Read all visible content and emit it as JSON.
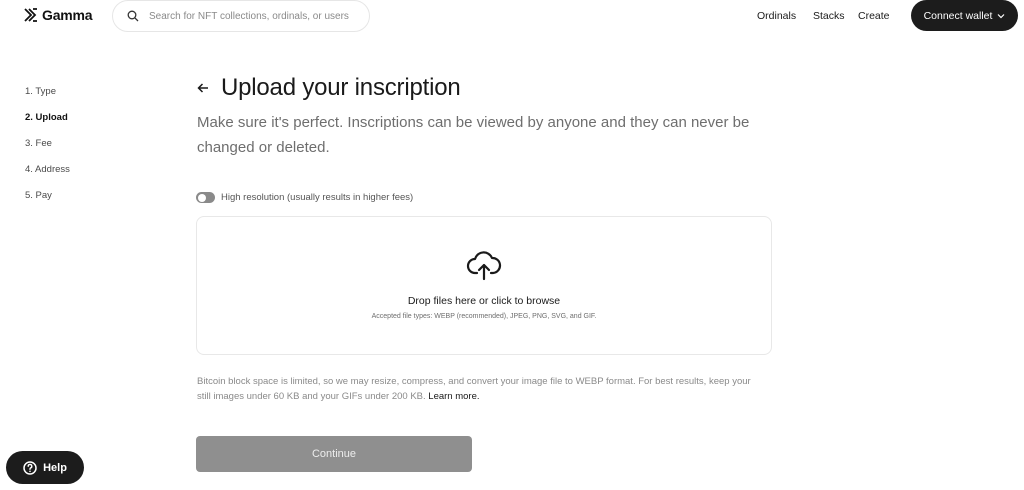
{
  "header": {
    "brand": "Gamma",
    "search_placeholder": "Search for NFT collections, ordinals, or users",
    "nav": [
      "Ordinals",
      "Stacks",
      "Create"
    ],
    "connect_label": "Connect wallet"
  },
  "steps": [
    "1. Type",
    "2. Upload",
    "3. Fee",
    "4. Address",
    "5. Pay"
  ],
  "active_step": "2. Upload",
  "main": {
    "title": "Upload your inscription",
    "subtitle": "Make sure it's perfect. Inscriptions can be viewed by anyone and they can never be changed or deleted.",
    "toggle_label": "High resolution (usually results in higher fees)",
    "toggle_on": false,
    "drop_main": "Drop files here or click to browse",
    "drop_sub": "Accepted file types: WEBP (recommended), JPEG, PNG, SVG, and GIF.",
    "note": "Bitcoin block space is limited, so we may resize, compress, and convert your image file to WEBP format. For best results, keep your still images under 60 KB and your GIFs under 200 KB.",
    "learn_more": "Learn more.",
    "continue_label": "Continue"
  },
  "help_label": "Help",
  "colors": {
    "primary_dark": "#1c1c1c",
    "disabled_button": "#8f8f8f",
    "muted_text": "#6e6e6e",
    "border": "#e8e8e8"
  },
  "icons": [
    "gamma-logo-icon",
    "search-icon",
    "chevron-down-icon",
    "back-arrow-icon",
    "cloud-upload-icon",
    "help-circle-icon"
  ]
}
